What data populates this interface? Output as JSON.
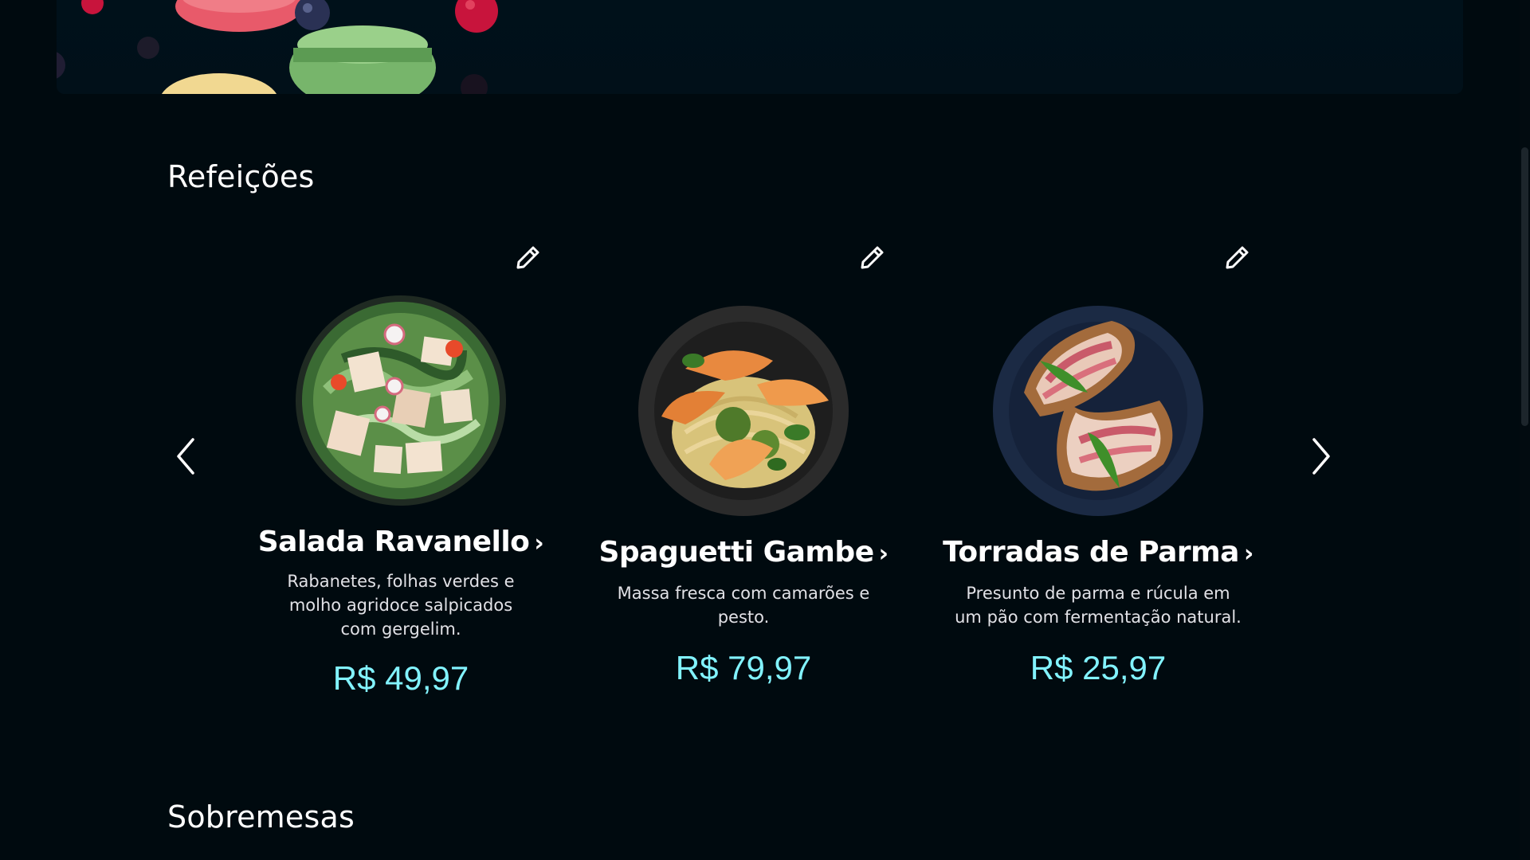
{
  "sections": {
    "meals_title": "Refeições",
    "desserts_title": "Sobremesas"
  },
  "carousel": {
    "prev_icon": "chevron-left-icon",
    "next_icon": "chevron-right-icon"
  },
  "dishes": [
    {
      "name": "Salada Ravanello",
      "chevron": "›",
      "description": "Rabanetes, folhas verdes e molho agridoce salpicados com gergelim.",
      "price": "R$ 49,97",
      "edit_icon": "pencil-icon"
    },
    {
      "name": "Spaguetti Gambe",
      "chevron": "›",
      "description": "Massa fresca com camarões e pesto.",
      "price": "R$ 79,97",
      "edit_icon": "pencil-icon"
    },
    {
      "name": "Torradas de Parma",
      "chevron": "›",
      "description": "Presunto de parma e rúcula em um pão com fermentação natural.",
      "price": "R$ 25,97",
      "edit_icon": "pencil-icon"
    }
  ],
  "colors": {
    "background": "#000a0f",
    "price": "#82f3ff",
    "text": "#e1e1e6"
  }
}
